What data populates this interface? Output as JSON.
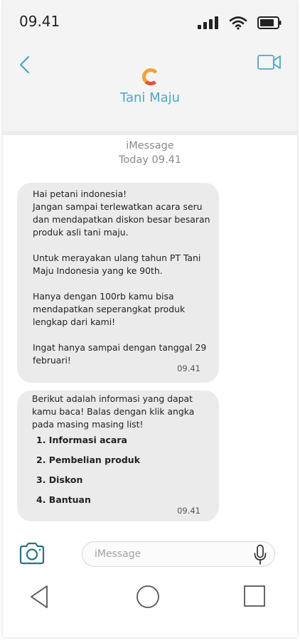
{
  "status_bar": {
    "time": "09.41"
  },
  "header": {
    "contact_name": "Tani Maju",
    "logo_letter": "C",
    "back_icon": "chevron-left-icon",
    "video_icon": "video-camera-icon",
    "accent_color": "#4aa9c4"
  },
  "thread": {
    "service_label": "iMessage",
    "date_label": "Today 09.41"
  },
  "messages": [
    {
      "text": "Hai petani indonesia!\nJangan sampai terlewatkan acara seru dan mendapatkan diskon besar besaran produk asli tani maju.\n\nUntuk merayakan ulang tahun PT Tani Maju Indonesia yang ke 90th.\n\nHanya dengan 100rb kamu bisa mendapatkan seperangkat produk lengkap dari kami!\n\nIngat hanya sampai dengan tanggal 29 februari!",
      "time": "09.41"
    },
    {
      "text": "Berikut adalah informasi yang dapat kamu baca! Balas dengan klik angka pada masing masing list!",
      "options": [
        "1. Informasi acara",
        "2. Pembelian produk",
        "3. Diskon",
        "4. Bantuan"
      ],
      "time": "09.41"
    }
  ],
  "composer": {
    "placeholder": "iMessage",
    "camera_icon": "camera-icon",
    "mic_icon": "microphone-icon"
  },
  "nav_bar": {
    "icons": [
      "back-triangle-icon",
      "home-circle-icon",
      "recent-square-icon"
    ]
  }
}
